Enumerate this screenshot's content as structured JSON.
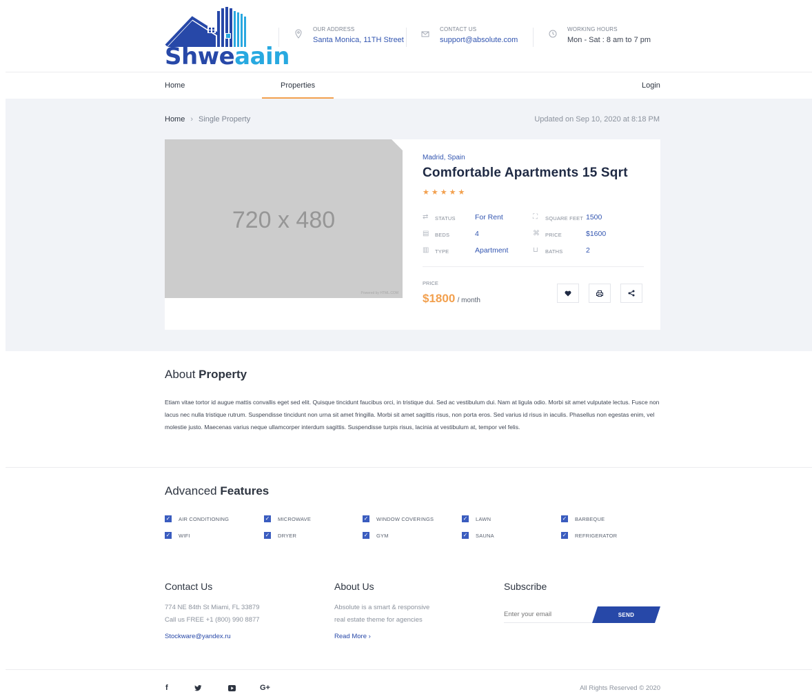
{
  "brand": {
    "part1": "Shwe",
    "part2": "aain"
  },
  "header": {
    "address": {
      "label": "OUR ADDRESS",
      "value": "Santa Monica, 11TH Street"
    },
    "contact": {
      "label": "CONTACT US",
      "value": "support@absolute.com"
    },
    "hours": {
      "label": "WORKING HOURS",
      "value": "Mon - Sat : 8 am to 7 pm"
    }
  },
  "nav": {
    "home": "Home",
    "properties": "Properties",
    "login": "Login"
  },
  "breadcrumb": {
    "home": "Home",
    "separator": "›",
    "current": "Single Property"
  },
  "updated": "Updated on Sep 10, 2020 at 8:18 PM",
  "image": {
    "placeholder": "720 x 480",
    "credit": "Powered by HTML.COM"
  },
  "property": {
    "location": "Madrid, Spain",
    "title": "Comfortable Apartments 15 Sqrt",
    "rating": 5,
    "stars": "★★★★★",
    "specs": {
      "status": {
        "label": "STATUS",
        "value": "For Rent"
      },
      "beds": {
        "label": "BEDS",
        "value": "4"
      },
      "type": {
        "label": "TYPE",
        "value": "Apartment"
      },
      "sqft": {
        "label": "SQUARE FEET",
        "value": "1500"
      },
      "price": {
        "label": "PRICE",
        "value": "$1600"
      },
      "baths": {
        "label": "BATHS",
        "value": "2"
      }
    },
    "price_label": "PRICE",
    "price": "$1800",
    "price_unit": "/ month"
  },
  "about": {
    "title_light": "About",
    "title_bold": "Property",
    "text": "Etiam vitae tortor id augue mattis convallis eget sed elit. Quisque tincidunt faucibus orci, in tristique dui. Sed ac vestibulum dui. Nam at ligula odio. Morbi sit amet vulputate lectus. Fusce non lacus nec nulla tristique rutrum. Suspendisse tincidunt non urna sit amet fringilla. Morbi sit amet sagittis risus, non porta eros. Sed varius id risus in iaculis. Phasellus non egestas enim, vel molestie justo. Maecenas varius neque ullamcorper interdum sagittis. Suspendisse turpis risus, lacinia at vestibulum at, tempor vel felis."
  },
  "features": {
    "title_light": "Advanced",
    "title_bold": "Features",
    "items": [
      "AIR CONDITIONING",
      "MICROWAVE",
      "WINDOW COVERINGS",
      "LAWN",
      "BARBEQUE",
      "WIFI",
      "DRYER",
      "GYM",
      "SAUNA",
      "REFRIGERATOR"
    ]
  },
  "footer": {
    "contact": {
      "title": "Contact Us",
      "address": "774 NE 84th St Miami, FL 33879",
      "phone": "Call us FREE +1 (800) 990 8877",
      "email": "Stockware@yandex.ru"
    },
    "about": {
      "title": "About Us",
      "line1": "Absolute is a smart & responsive",
      "line2": "real estate theme for agencies",
      "link": "Read More ›"
    },
    "subscribe": {
      "title": "Subscribe",
      "placeholder": "Enter your email",
      "button": "SEND"
    },
    "social": {
      "facebook": "f",
      "twitter": "🐦",
      "youtube": "▶",
      "google": "G+"
    },
    "rights": "All Rights Reserved © 2020"
  },
  "colors": {
    "primary": "#2748a8",
    "accent": "#f2a04e",
    "link": "#3255b0",
    "hero_bg": "#f1f3f7"
  }
}
